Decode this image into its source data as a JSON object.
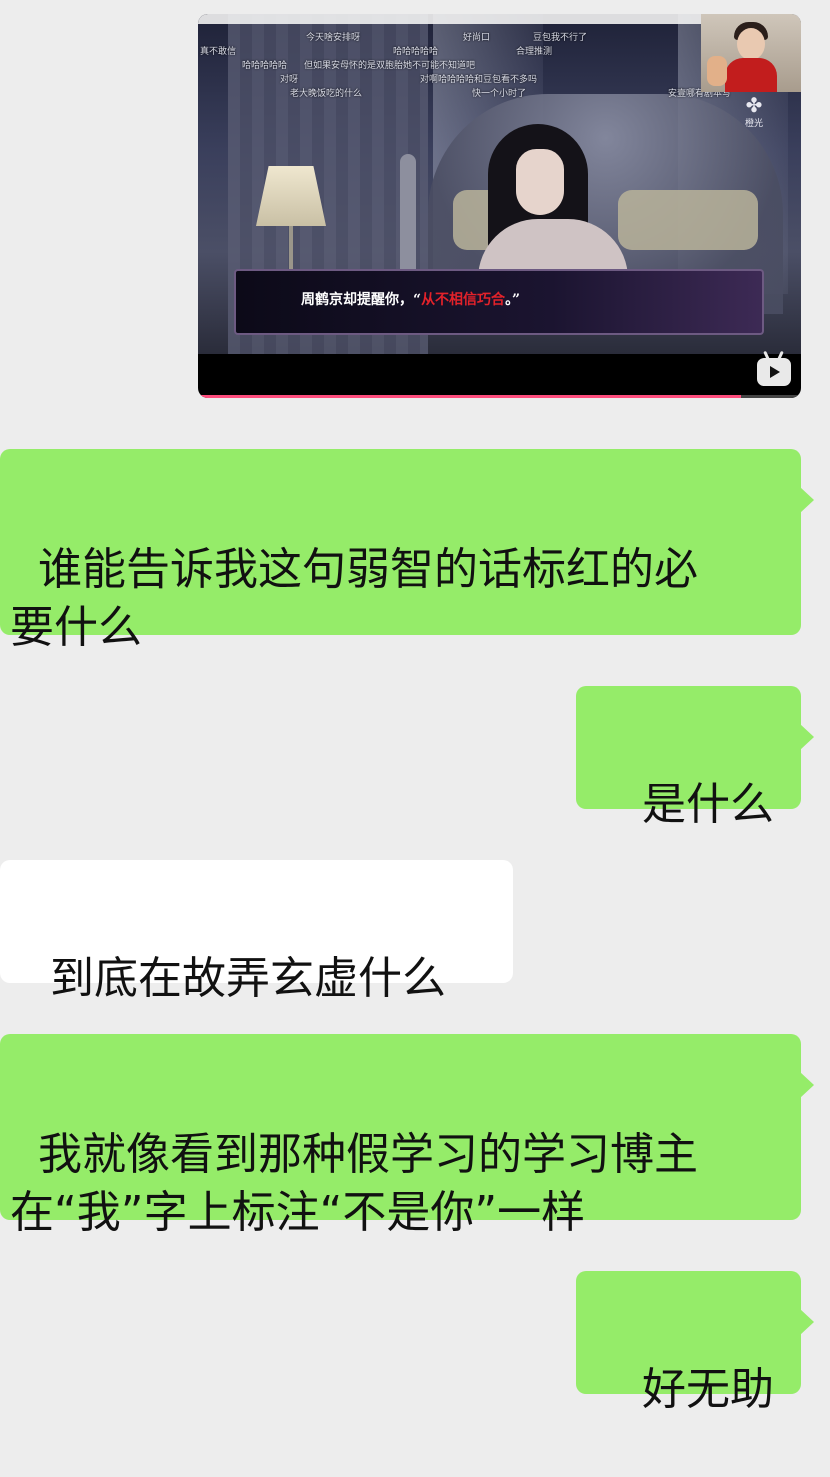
{
  "video_message": {
    "dialog_speaker": "周鹤京却提醒你，",
    "dialog_open_quote": "“",
    "dialog_highlight": "从不相信巧合",
    "dialog_close": "。”",
    "highlight_color": "#e3222a",
    "brand_name": "橙光",
    "danmaku": [
      "今天啥安排呀",
      "好尚口",
      "豆包我不行了",
      "真不敢信",
      "哈哈哈哈哈",
      "合理推测",
      "哈哈哈哈哈",
      "但如果安母怀的是双胞胎她不可能不知道吧",
      "对呀",
      "对啊哈哈哈哈和豆包看不多吗",
      "老大晚饭吃的什么",
      "快一个小时了",
      "安壹哪有剧本写"
    ],
    "progress": 0.9,
    "icon": "video-play-icon"
  },
  "messages": [
    {
      "side": "me",
      "text": "谁能告诉我这句弱智的话标红的必\n要什么"
    },
    {
      "side": "me",
      "text": "是什么"
    },
    {
      "side": "other",
      "text": "到底在故弄玄虚什么"
    },
    {
      "side": "me",
      "text": "我就像看到那种假学习的学习博主\n在“我”字上标注“不是你”一样"
    },
    {
      "side": "me",
      "text": "好无助"
    }
  ],
  "colors": {
    "background": "#ededed",
    "my_bubble": "#95ec69",
    "other_bubble": "#ffffff"
  }
}
